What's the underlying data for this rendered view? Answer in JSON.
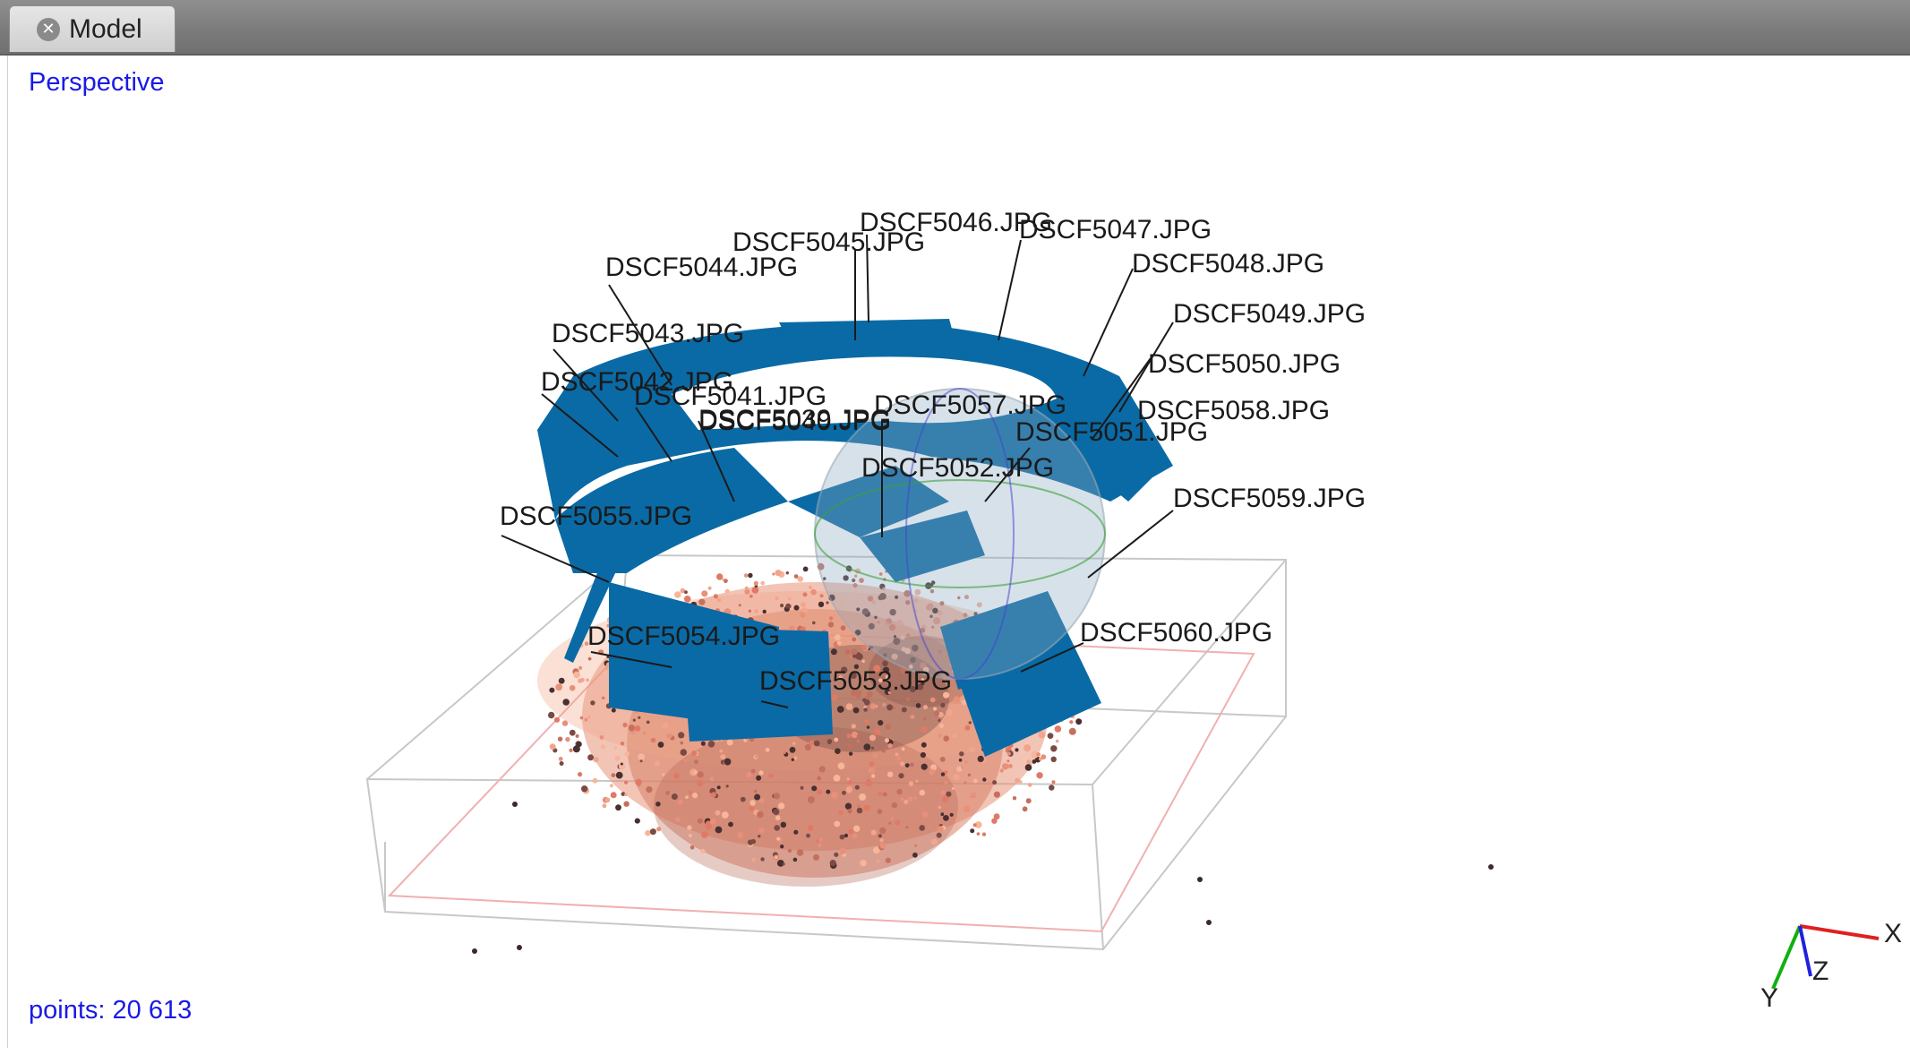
{
  "tab": {
    "title": "Model"
  },
  "viewport": {
    "projection": "Perspective",
    "points": "points: 20 613",
    "point_count": 20613
  },
  "cameras": [
    "DSCF5046.JPG",
    "DSCF5047.JPG",
    "DSCF5045.JPG",
    "DSCF5048.JPG",
    "DSCF5044.JPG",
    "DSCF5049.JPG",
    "DSCF5043.JPG",
    "DSCF5050.JPG",
    "DSCF5042.JPG",
    "DSCF5041.JPG",
    "DSCF5057.JPG",
    "DSCF5058.JPG",
    "DSCF5040.JPG",
    "DSCF5039.JPG",
    "DSCF5051.JPG",
    "DSCF5052.JPG",
    "DSCF5059.JPG",
    "DSCF5055.JPG",
    "DSCF5054.JPG",
    "DSCF5060.JPG",
    "DSCF5053.JPG"
  ],
  "axes": {
    "x": "X",
    "y": "Y",
    "z": "Z"
  },
  "colors": {
    "label_blue": "#1a1ae6",
    "camera_blue": "#0a6aa5",
    "x_axis": "#e02020",
    "y_axis": "#10b010",
    "z_axis": "#2020e0"
  }
}
